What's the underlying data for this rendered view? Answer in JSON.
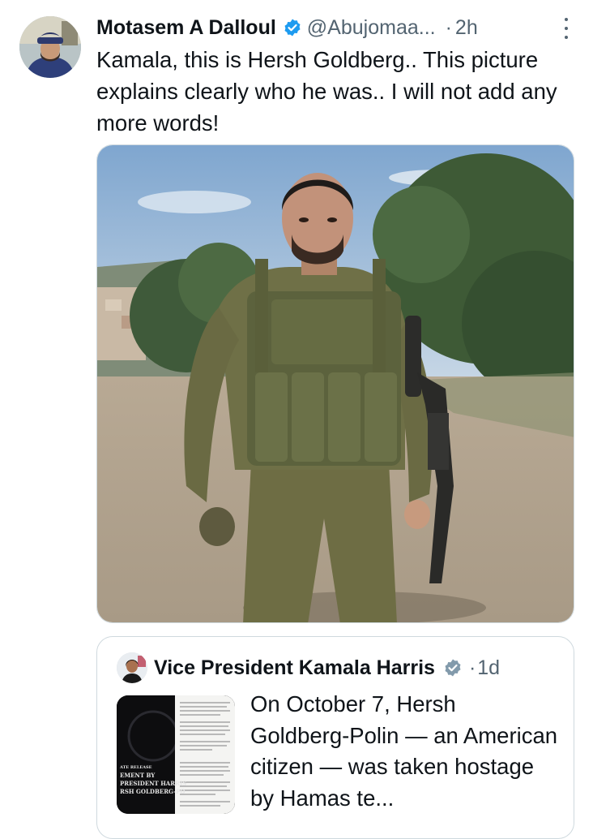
{
  "tweet": {
    "author_name": "Motasem A Dalloul",
    "handle": "@Abujomaa...",
    "separator": "·",
    "time": "2h",
    "text": "Kamala, this is Hersh Goldberg.. This picture explains clearly who he was.. I will not add any more words!",
    "verified_color": "#1d9bf0"
  },
  "quoted_tweet": {
    "author_name": "Vice President Kamala Harris",
    "separator": "·",
    "time": "1d",
    "text": "On October 7, Hersh Goldberg-Polin — an American citizen — was taken hostage by Hamas te...",
    "verified_color": "#829aab",
    "thumbnail_caption_lines": [
      "ATE RELEASE",
      "EMENT BY",
      "PRESIDENT HARRIS",
      "RSH GOLDBERG-PO"
    ]
  },
  "icons": {
    "verified": "verified-badge-icon",
    "more": "more-options-icon"
  }
}
